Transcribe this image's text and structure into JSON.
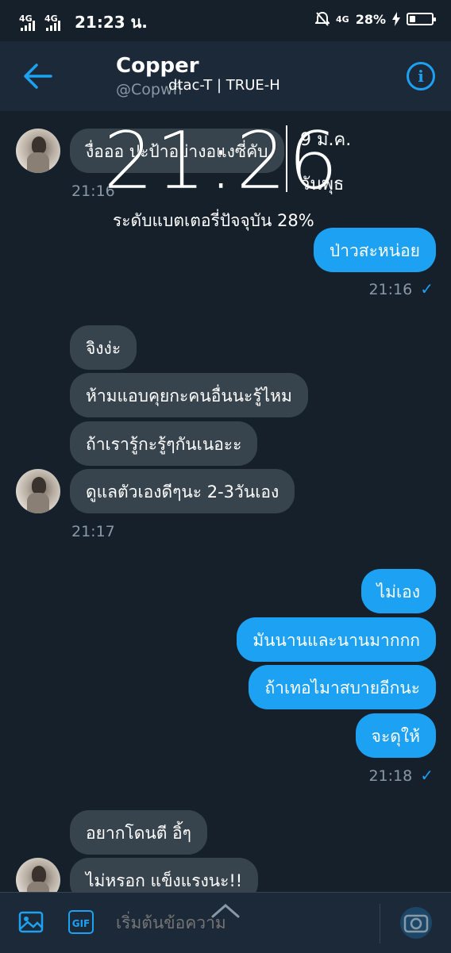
{
  "status_bar": {
    "net1": "4G",
    "net2": "4G",
    "time": "21:23 น.",
    "net3": "4G",
    "battery_pct": "28%",
    "battery_level": 0.28
  },
  "header": {
    "name": "Copper",
    "handle": "@Copwfi",
    "carrier": "dtac-T | TRUE-H"
  },
  "overlay": {
    "time": "21:26",
    "date": "9 ม.ค.",
    "day": "วันพุธ",
    "battery_text": "ระดับแบตเตอรี่ปัจจุบัน 28%"
  },
  "messages": [
    {
      "text": "งื่อออ ปะป้าอย่างอแงซี่คับ"
    },
    {
      "text": "ป่าวสะหน่อย"
    },
    {
      "text": "จิงง่ะ"
    },
    {
      "text": "ห้ามแอบคุยกะคนอื่นนะรู้ไหม"
    },
    {
      "text": "ถ้าเรารู้กะรู้ๆกันเนอะะ"
    },
    {
      "text": "ดูแลตัวเองดีๆนะ 2-3วันเอง"
    },
    {
      "text": "ไม่เอง"
    },
    {
      "text": "มันนานและนานมากกก"
    },
    {
      "text": "ถ้าเทอไมาสบายอีกนะ"
    },
    {
      "text": "จะดุให้"
    },
    {
      "text": "อยากโดนตี อิ้ๆ"
    },
    {
      "text": "ไม่หรอก แข็งแรงนะ!!"
    }
  ],
  "timestamps": [
    "21:16",
    "21:16",
    "21:17",
    "21:18"
  ],
  "composer": {
    "placeholder": "เริ่มต้นข้อความ",
    "gif_label": "GIF"
  },
  "colors": {
    "background": "#15202b",
    "header": "#1c2938",
    "incoming": "#38444d",
    "outgoing": "#1da1f2",
    "muted": "#8899a6"
  }
}
